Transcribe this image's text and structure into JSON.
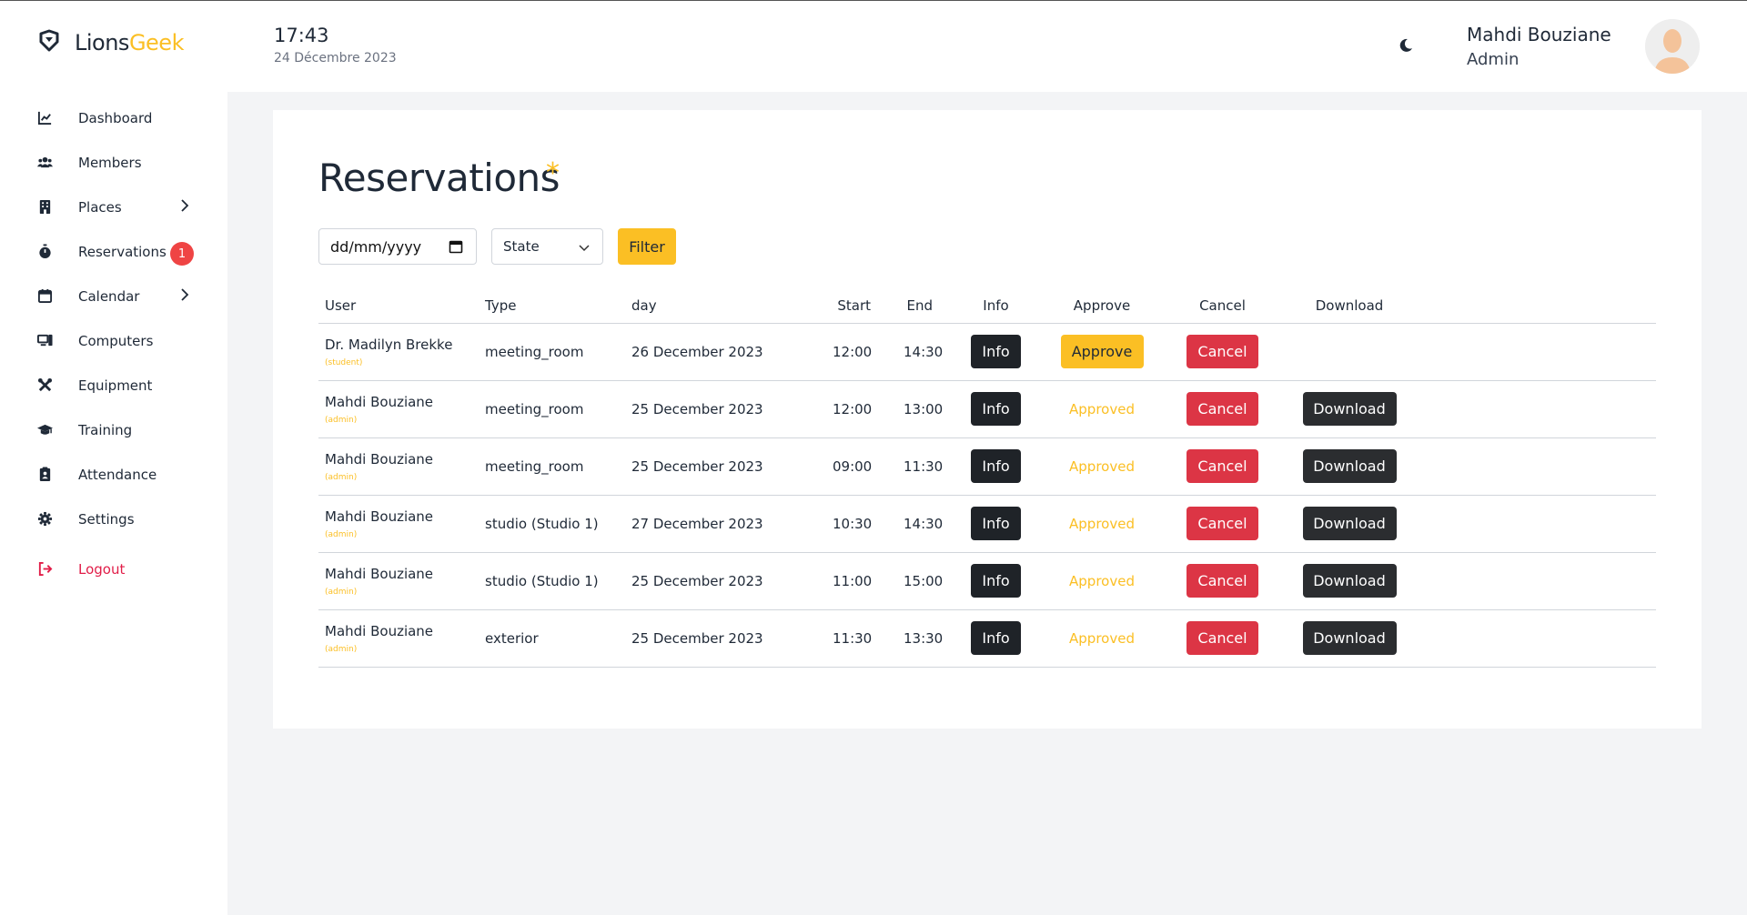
{
  "brand": {
    "name_part1": "Lions",
    "name_part2": "Geek"
  },
  "header": {
    "time": "17:43",
    "date": "24 Décembre 2023",
    "user_name": "Mahdi Bouziane",
    "user_role": "Admin"
  },
  "sidebar": {
    "items": [
      {
        "label": "Dashboard",
        "icon": "chart-line-icon"
      },
      {
        "label": "Members",
        "icon": "users-icon"
      },
      {
        "label": "Places",
        "icon": "building-icon",
        "has_submenu": true
      },
      {
        "label": "Reservations",
        "icon": "stopwatch-icon",
        "badge": "1"
      },
      {
        "label": "Calendar",
        "icon": "calendar-icon",
        "has_submenu": true
      },
      {
        "label": "Computers",
        "icon": "computer-icon"
      },
      {
        "label": "Equipment",
        "icon": "tools-icon"
      },
      {
        "label": "Training",
        "icon": "graduation-cap-icon"
      },
      {
        "label": "Attendance",
        "icon": "clipboard-icon"
      },
      {
        "label": "Settings",
        "icon": "gear-icon"
      }
    ],
    "logout": "Logout"
  },
  "page": {
    "title": "Reservations",
    "title_mark": "*",
    "date_placeholder": "dd/mm/yyyy",
    "state_select": "State",
    "filter_button": "Filter"
  },
  "table": {
    "headers": {
      "user": "User",
      "type": "Type",
      "day": "day",
      "start": "Start",
      "end": "End",
      "info": "Info",
      "approve": "Approve",
      "cancel": "Cancel",
      "download": "Download"
    },
    "info_label": "Info",
    "approve_label": "Approve",
    "approved_label": "Approved",
    "cancel_label": "Cancel",
    "download_label": "Download",
    "rows": [
      {
        "user": "Dr. Madilyn Brekke",
        "role": "(student)",
        "type": "meeting_room",
        "day": "26 December 2023",
        "start": "12:00",
        "end": "14:30",
        "approved": false
      },
      {
        "user": "Mahdi Bouziane",
        "role": "(admin)",
        "type": "meeting_room",
        "day": "25 December 2023",
        "start": "12:00",
        "end": "13:00",
        "approved": true
      },
      {
        "user": "Mahdi Bouziane",
        "role": "(admin)",
        "type": "meeting_room",
        "day": "25 December 2023",
        "start": "09:00",
        "end": "11:30",
        "approved": true
      },
      {
        "user": "Mahdi Bouziane",
        "role": "(admin)",
        "type": "studio (Studio 1)",
        "day": "27 December 2023",
        "start": "10:30",
        "end": "14:30",
        "approved": true
      },
      {
        "user": "Mahdi Bouziane",
        "role": "(admin)",
        "type": "studio (Studio 1)",
        "day": "25 December 2023",
        "start": "11:00",
        "end": "15:00",
        "approved": true
      },
      {
        "user": "Mahdi Bouziane",
        "role": "(admin)",
        "type": "exterior",
        "day": "25 December 2023",
        "start": "11:30",
        "end": "13:30",
        "approved": true
      }
    ]
  },
  "colors": {
    "accent": "#fbbf24",
    "danger": "#dc3545",
    "dark": "#1f2328",
    "badge": "#ef4444",
    "logout": "#e11d48"
  }
}
